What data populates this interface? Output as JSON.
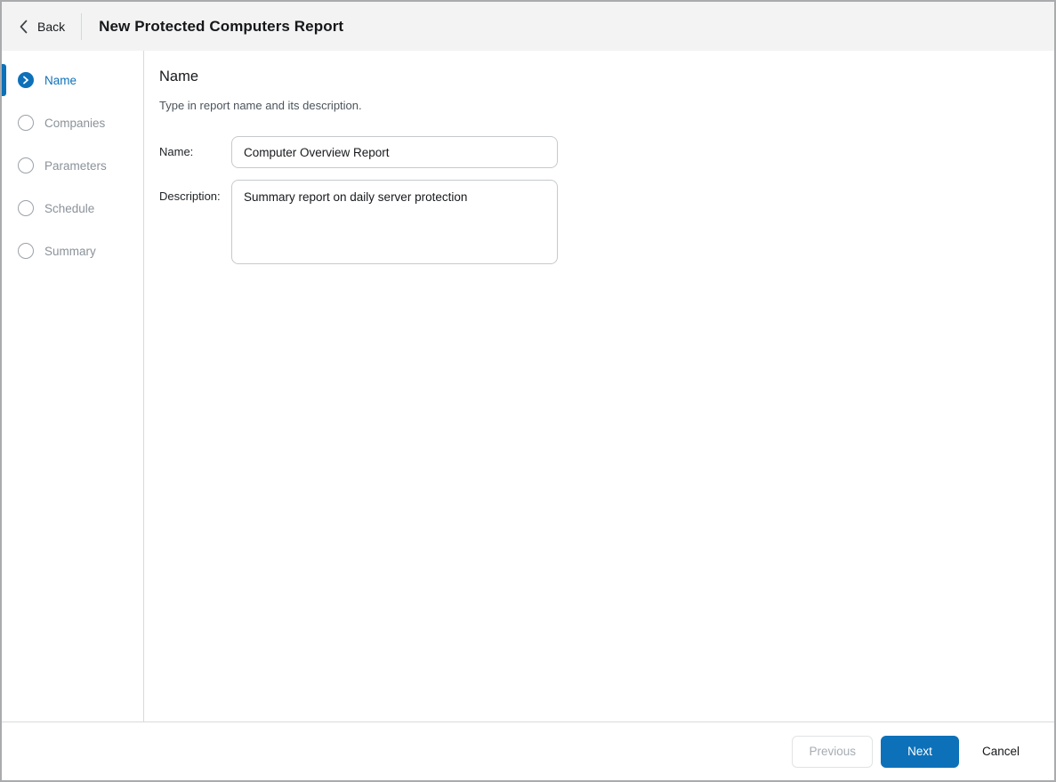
{
  "header": {
    "back_label": "Back",
    "title": "New Protected Computers Report"
  },
  "icons": {
    "back": "chevron-left",
    "step_active_badge": "chevron-right-in-filled-circle",
    "step_inactive_badge": "empty-circle"
  },
  "wizard": {
    "steps": [
      {
        "label": "Name",
        "active": true
      },
      {
        "label": "Companies",
        "active": false
      },
      {
        "label": "Parameters",
        "active": false
      },
      {
        "label": "Schedule",
        "active": false
      },
      {
        "label": "Summary",
        "active": false
      }
    ]
  },
  "main": {
    "heading": "Name",
    "subtitle": "Type in report name and its description.",
    "form": {
      "name_label": "Name:",
      "name_value": "Computer Overview Report",
      "description_label": "Description:",
      "description_value": "Summary report on daily server protection"
    }
  },
  "footer": {
    "previous_label": "Previous",
    "next_label": "Next",
    "cancel_label": "Cancel"
  },
  "colors": {
    "accent_blue": "#0d71b9",
    "header_background": "#f2f3f2",
    "inactive_gray": "#8b9299",
    "border_gray": "#d9dadb",
    "input_border": "#c6cacd",
    "window_border": "#a9abac"
  }
}
